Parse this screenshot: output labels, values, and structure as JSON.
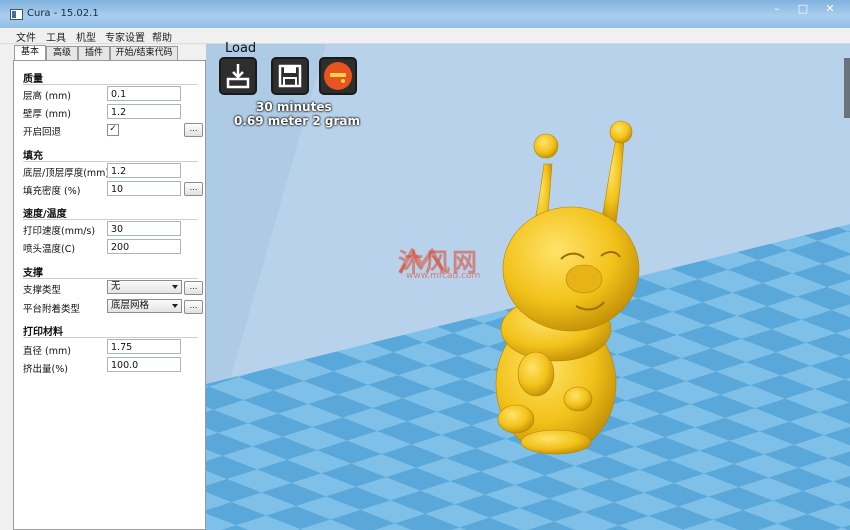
{
  "window": {
    "title": "Cura - 15.02.1"
  },
  "menu": [
    "文件",
    "工具",
    "机型",
    "专家设置",
    "帮助"
  ],
  "tabs": [
    "基本",
    "高级",
    "插件",
    "开始/结束代码"
  ],
  "sections": {
    "quality": {
      "title": "质量",
      "layer_height_label": "层高 (mm)",
      "layer_height_value": "0.1",
      "shell_label": "壁厚 (mm)",
      "shell_value": "1.2",
      "retraction_label": "开启回退",
      "retraction_checked": "✓"
    },
    "fill": {
      "title": "填充",
      "bottom_top_label": "底层/顶层厚度(mm)",
      "bottom_top_value": "1.2",
      "density_label": "填充密度 (%)",
      "density_value": "10"
    },
    "speed": {
      "title": "速度/温度",
      "print_speed_label": "打印速度(mm/s)",
      "print_speed_value": "30",
      "nozzle_temp_label": "喷头温度(C)",
      "nozzle_temp_value": "200"
    },
    "support": {
      "title": "支撑",
      "support_type_label": "支撑类型",
      "support_type_value": "无",
      "adhesion_label": "平台附着类型",
      "adhesion_value": "底层网格"
    },
    "filament": {
      "title": "打印材料",
      "diameter_label": "直径 (mm)",
      "diameter_value": "1.75",
      "flow_label": "挤出量(%)",
      "flow_value": "100.0"
    }
  },
  "dots_label": "...",
  "toolbar": {
    "load_label": "Load",
    "print_time": "30 minutes",
    "print_material": "0.69 meter 2 gram"
  },
  "watermark": {
    "brand": "沐风网",
    "url": "www.mfcad.com"
  },
  "icons": [
    "load-icon",
    "save-icon",
    "print-orange-icon"
  ],
  "colors": {
    "model": "#f2c21a",
    "floor_tile_a": "#5aa8d9",
    "floor_tile_b": "#7ec0e8",
    "sky": "#b7d2ea"
  }
}
